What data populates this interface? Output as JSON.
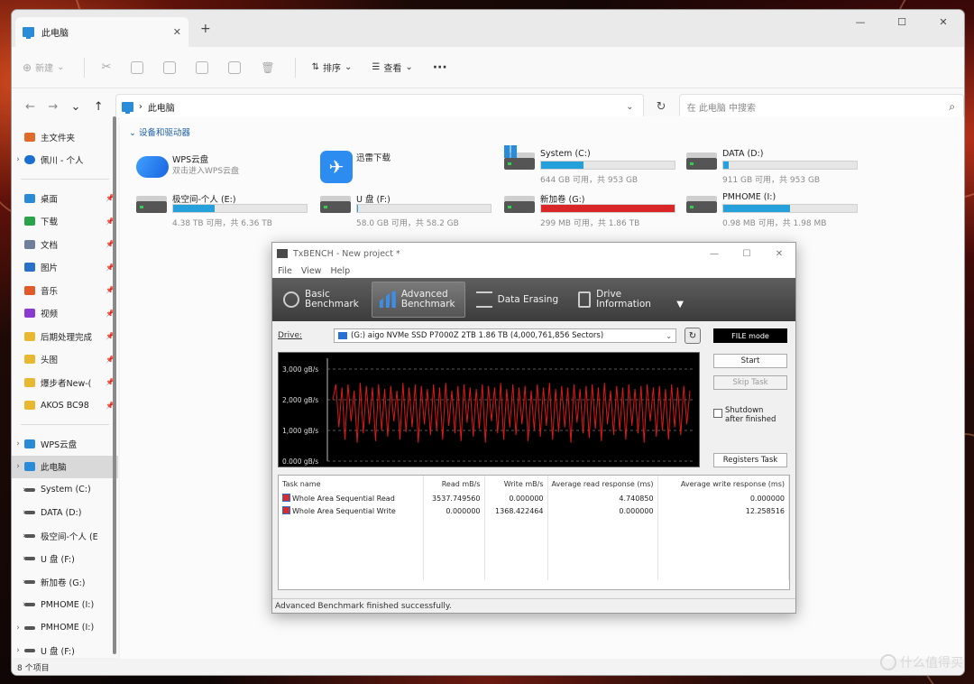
{
  "explorer": {
    "tab_title": "此电脑",
    "toolbar": {
      "new_label": "新建",
      "sort_label": "排序",
      "view_label": "查看",
      "more_label": "···"
    },
    "address": {
      "path": "此电脑",
      "search_placeholder": "在 此电脑 中搜索"
    },
    "sidebar": {
      "quick": [
        {
          "label": "主文件夹",
          "pinned": false
        },
        {
          "label": "佩川 - 个人",
          "pinned": false
        }
      ],
      "pinned": [
        {
          "label": "桌面",
          "color": "#2a8cd8"
        },
        {
          "label": "下载",
          "color": "#2aa34a"
        },
        {
          "label": "文档",
          "color": "#6f7f9a"
        },
        {
          "label": "图片",
          "color": "#2a70c8"
        },
        {
          "label": "音乐",
          "color": "#e05a2a"
        },
        {
          "label": "视频",
          "color": "#8a3ad0"
        },
        {
          "label": "后期处理完成",
          "color": "#e8b830"
        },
        {
          "label": "头图",
          "color": "#e8b830"
        },
        {
          "label": "爆步者New-(",
          "color": "#e8b830"
        },
        {
          "label": "AKOS BC98",
          "color": "#e8b830"
        }
      ],
      "tree": [
        {
          "label": "WPS云盘",
          "indent": 0
        },
        {
          "label": "此电脑",
          "indent": 0,
          "selected": true
        },
        {
          "label": "System (C:)",
          "indent": 1
        },
        {
          "label": "DATA (D:)",
          "indent": 1
        },
        {
          "label": "极空间-个人 (E",
          "indent": 1
        },
        {
          "label": "U 盘 (F:)",
          "indent": 1
        },
        {
          "label": "新加卷 (G:)",
          "indent": 1
        },
        {
          "label": "PMHOME (I:)",
          "indent": 1
        },
        {
          "label": "PMHOME (I:)",
          "indent": 0
        },
        {
          "label": "U 盘 (F:)",
          "indent": 0
        }
      ]
    },
    "section_title": "设备和驱动器",
    "apps": [
      {
        "name": "WPS云盘",
        "sub": "双击进入WPS云盘"
      },
      {
        "name": "迅雷下载",
        "sub": ""
      }
    ],
    "drives": [
      {
        "name": "System (C:)",
        "free": "644 GB 可用，共 953 GB",
        "used": 0.32,
        "critical": false
      },
      {
        "name": "DATA (D:)",
        "free": "911 GB 可用，共 953 GB",
        "used": 0.04,
        "critical": false
      },
      {
        "name": "极空间-个人 (E:)",
        "free": "4.38 TB 可用，共 6.36 TB",
        "used": 0.31,
        "critical": false
      },
      {
        "name": "U 盘 (F:)",
        "free": "58.0 GB 可用，共 58.2 GB",
        "used": 0.003,
        "critical": false
      },
      {
        "name": "新加卷 (G:)",
        "free": "299 MB 可用，共 1.86 TB",
        "used": 0.9998,
        "critical": true
      },
      {
        "name": "PMHOME (I:)",
        "free": "0.98 MB 可用，共 1.98 MB",
        "used": 0.5,
        "critical": false
      }
    ],
    "status": "8 个项目"
  },
  "txbench": {
    "title": "TxBENCH - New project *",
    "menu": [
      "File",
      "View",
      "Help"
    ],
    "tabs": [
      {
        "label1": "Basic",
        "label2": "Benchmark",
        "active": false
      },
      {
        "label1": "Advanced",
        "label2": "Benchmark",
        "active": true
      },
      {
        "label1": "Data Erasing",
        "label2": "",
        "active": false
      },
      {
        "label1": "Drive",
        "label2": "Information",
        "active": false
      }
    ],
    "drive_label": "Drive:",
    "drive_value": "(G:) aigo NVMe SSD P7000Z 2TB  1.86 TB (4,000,761,856 Sectors)",
    "file_mode": "FILE mode",
    "start": "Start",
    "skip_task": "Skip Task",
    "shutdown_line1": "Shutdown",
    "shutdown_line2": "after finished",
    "registers_task": "Registers Task",
    "columns": [
      "Task name",
      "Read mB/s",
      "Write mB/s",
      "Average read response (ms)",
      "Average write response (ms)"
    ],
    "rows": [
      [
        "Whole Area Sequential Read",
        "3537.749560",
        "0.000000",
        "4.740850",
        "0.000000"
      ],
      [
        "Whole Area Sequential Write",
        "0.000000",
        "1368.422464",
        "0.000000",
        "12.258516"
      ]
    ],
    "status": "Advanced Benchmark finished successfully."
  },
  "chart_data": {
    "type": "line",
    "title": "",
    "xlabel": "",
    "ylabel": "",
    "ylim": [
      0,
      3000
    ],
    "y_ticks": [
      "3,000 gB/s",
      "2,000 gB/s",
      "1,000 gB/s",
      "0.000 gB/s"
    ],
    "grid": true,
    "series": [
      {
        "color": "#e01818",
        "description_values": "oscillating throughput roughly between 400 and 2600",
        "values": [
          2000,
          2500,
          1100,
          2400,
          700,
          2500,
          1300,
          2300,
          600,
          2550,
          900,
          2450,
          1200,
          2400,
          650,
          2500,
          1000,
          2350,
          800,
          2450,
          1300,
          2300,
          700,
          2550,
          950,
          2400,
          1100,
          2500,
          600,
          2450,
          1200,
          2350,
          850,
          2500,
          1000,
          2400,
          700,
          2550,
          1150,
          2300,
          900,
          2450,
          650,
          2500,
          1250,
          2400,
          800,
          2350,
          1050,
          2500,
          600,
          2450,
          1300,
          2400,
          900,
          2550,
          700,
          2350,
          1100,
          2500,
          850,
          2400,
          1200,
          2450,
          650,
          2300,
          1000,
          2500,
          800,
          2400,
          1150,
          2550,
          700,
          2350,
          950,
          2450,
          1100,
          2400,
          600,
          2500,
          1250,
          2350,
          900,
          2450,
          750,
          2500,
          1050,
          2400,
          650,
          2550,
          1200,
          2300,
          850,
          2450,
          1000,
          2400,
          700,
          2500,
          1150,
          2350,
          900,
          2450,
          600,
          2500,
          1300,
          2400,
          800,
          2450,
          1000,
          2350,
          700,
          2500,
          1100,
          2400,
          850,
          2450,
          1200,
          2300
        ]
      }
    ]
  },
  "watermark": "什么值得买"
}
